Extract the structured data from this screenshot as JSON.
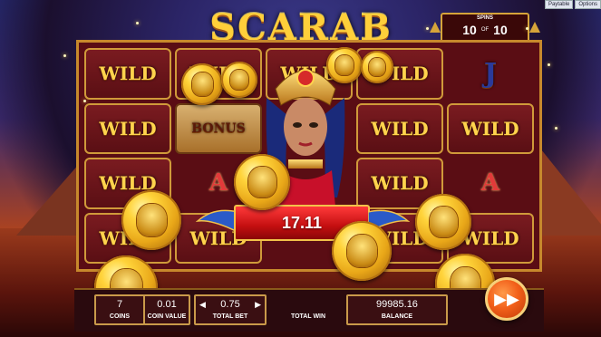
{
  "topmenu": [
    "Paytable",
    "Options"
  ],
  "logo": "SCARAB",
  "spins": {
    "label": "SPINS",
    "current": "10",
    "of": "OF",
    "total": "10"
  },
  "reels": [
    [
      "WILD",
      "WILD",
      "WILD",
      "WILD",
      "J"
    ],
    [
      "WILD",
      "BONUS",
      "",
      "WILD",
      "WILD"
    ],
    [
      "WILD",
      "A",
      "",
      "WILD",
      "A"
    ],
    [
      "WILD",
      "WILD",
      "",
      "WILD",
      "WILD"
    ]
  ],
  "win": {
    "amount": "17.11"
  },
  "bottom": {
    "coins_value": "7",
    "coins_label": "COINS",
    "coin_value_value": "0.01",
    "coin_value_label": "COIN VALUE",
    "total_bet_value": "0.75",
    "total_bet_label": "TOTAL BET",
    "total_win_label": "TOTAL WIN",
    "balance_value": "99985.16",
    "balance_label": "BALANCE"
  },
  "icons": {
    "fast_forward": "fast-forward-icon",
    "coin": "scarab-coin-icon"
  },
  "colors": {
    "gold": "#ffcf3a",
    "red": "#c40f10",
    "orange": "#f2601a"
  }
}
